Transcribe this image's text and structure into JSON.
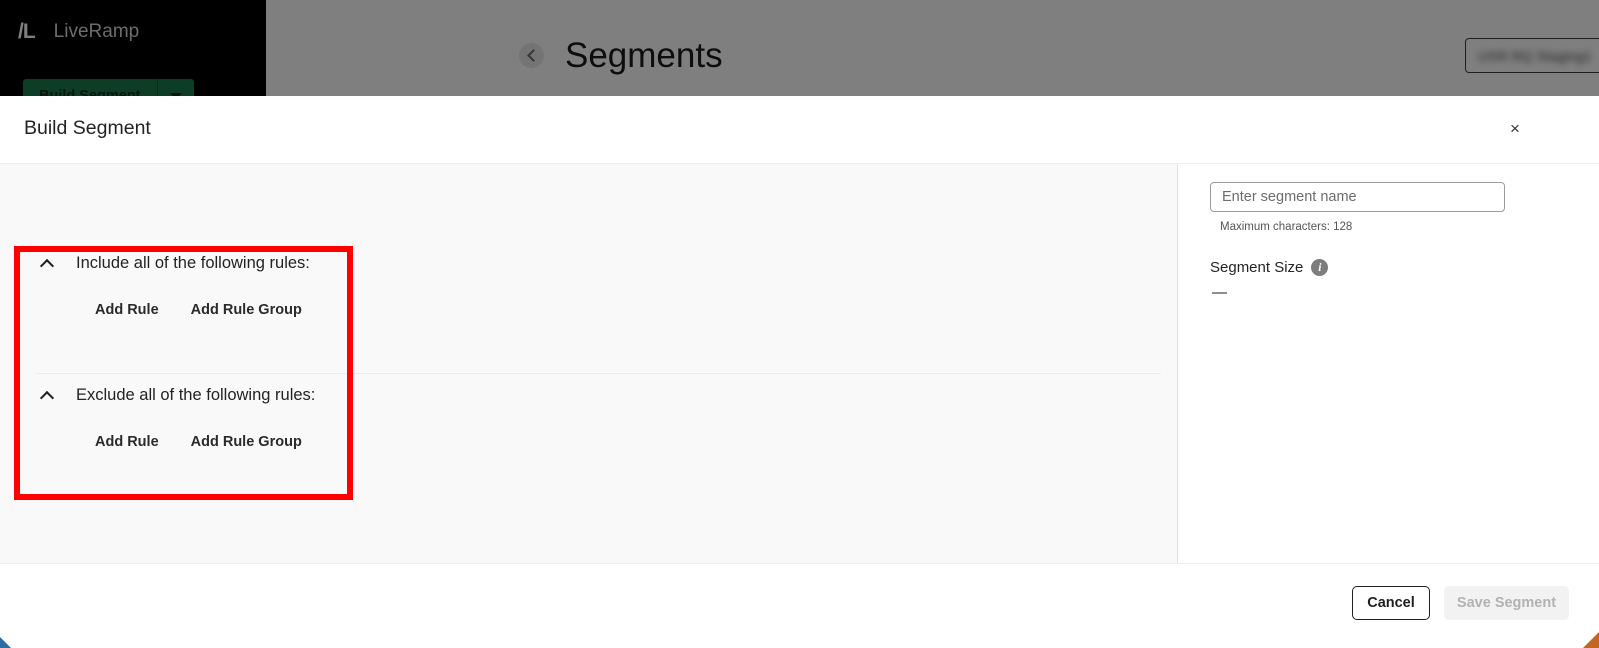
{
  "app": {
    "logo_mark": "/L",
    "logo_text": "LiveRamp",
    "build_segment_button": "Build Segment",
    "page_title": "Segments",
    "org_selector_value": "USR RQ Staging1",
    "back_icon": "chevron-left-icon",
    "help_icon": "help-circle-icon",
    "account_icon": "person-icon"
  },
  "modal": {
    "title": "Build Segment",
    "close_label": "×",
    "rules": {
      "sections": [
        {
          "title": "Include all of the following rules:",
          "collapse_state": "expanded",
          "actions": [
            {
              "label": "Add Rule"
            },
            {
              "label": "Add Rule Group"
            }
          ]
        },
        {
          "title": "Exclude all of the following rules:",
          "collapse_state": "expanded",
          "actions": [
            {
              "label": "Add Rule"
            },
            {
              "label": "Add Rule Group"
            }
          ]
        }
      ]
    },
    "details": {
      "segment_name_value": "",
      "segment_name_placeholder": "Enter segment name",
      "max_characters_hint": "Maximum characters: 128",
      "segment_size_label": "Segment Size",
      "segment_size_info_icon": "info-icon",
      "segment_size_value": "—"
    },
    "footer": {
      "cancel_label": "Cancel",
      "save_label": "Save Segment"
    }
  },
  "annotation": {
    "highlight_color": "#fe0000"
  }
}
